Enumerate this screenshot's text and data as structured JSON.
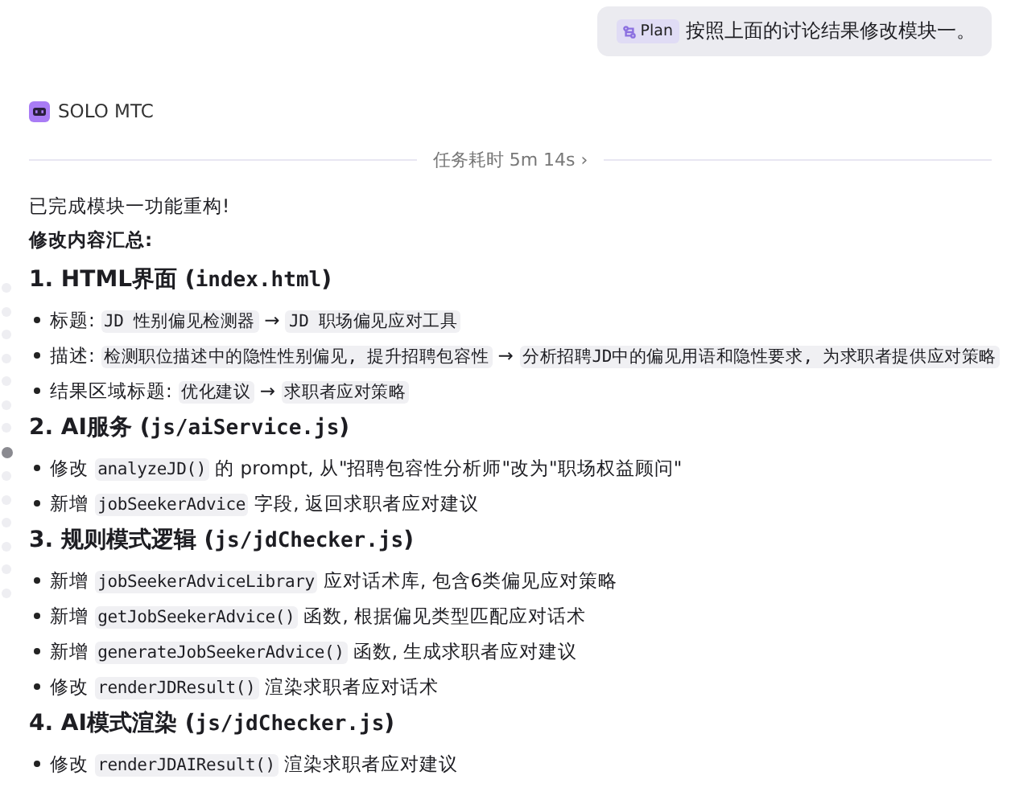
{
  "user_message": {
    "badge": "Plan",
    "text": "按照上面的讨论结果修改模块一。"
  },
  "agent": {
    "name": "SOLO MTC"
  },
  "duration": {
    "label": "任务耗时 5m 14s",
    "chevron": "›"
  },
  "nav_dots": [
    {
      "selected": false
    },
    {
      "selected": false
    },
    {
      "selected": false
    },
    {
      "selected": false
    },
    {
      "selected": false
    },
    {
      "selected": false
    },
    {
      "selected": false
    },
    {
      "selected": true
    },
    {
      "selected": false
    },
    {
      "selected": false
    },
    {
      "selected": false
    },
    {
      "selected": false
    },
    {
      "selected": false
    },
    {
      "selected": false
    }
  ],
  "content": [
    {
      "kind": "paragraph",
      "parts": [
        {
          "kind": "text",
          "text": "已完成模块一功能重构!"
        }
      ]
    },
    {
      "kind": "strong",
      "parts": [
        {
          "kind": "text",
          "text": "修改内容汇总:"
        }
      ]
    },
    {
      "kind": "heading",
      "parts": [
        {
          "kind": "text",
          "text": "1. HTML界面 ("
        },
        {
          "kind": "mono",
          "text": "index.html"
        },
        {
          "kind": "text",
          "text": ")"
        }
      ]
    },
    {
      "kind": "bullet",
      "parts": [
        {
          "kind": "text",
          "text": "标题: "
        },
        {
          "kind": "code",
          "text": "JD 性别偏见检测器"
        },
        {
          "kind": "text",
          "text": " → "
        },
        {
          "kind": "code",
          "text": "JD 职场偏见应对工具"
        }
      ]
    },
    {
      "kind": "bullet",
      "parts": [
        {
          "kind": "text",
          "text": "描述: "
        },
        {
          "kind": "code",
          "text": "检测职位描述中的隐性性别偏见, 提升招聘包容性"
        },
        {
          "kind": "text",
          "text": " → "
        },
        {
          "kind": "code",
          "text": "分析招聘JD中的偏见用语和隐性要求, 为求职者提供应对策略"
        }
      ]
    },
    {
      "kind": "bullet",
      "parts": [
        {
          "kind": "text",
          "text": "结果区域标题: "
        },
        {
          "kind": "code",
          "text": "优化建议"
        },
        {
          "kind": "text",
          "text": " → "
        },
        {
          "kind": "code",
          "text": "求职者应对策略"
        }
      ]
    },
    {
      "kind": "heading",
      "parts": [
        {
          "kind": "text",
          "text": "2. AI服务 ("
        },
        {
          "kind": "mono",
          "text": "js/aiService.js"
        },
        {
          "kind": "text",
          "text": ")"
        }
      ]
    },
    {
      "kind": "bullet",
      "parts": [
        {
          "kind": "text",
          "text": "修改 "
        },
        {
          "kind": "code",
          "text": "analyzeJD()"
        },
        {
          "kind": "text",
          "text": " 的 prompt, 从\"招聘包容性分析师\"改为\"职场权益顾问\""
        }
      ]
    },
    {
      "kind": "bullet",
      "parts": [
        {
          "kind": "text",
          "text": "新增 "
        },
        {
          "kind": "code",
          "text": "jobSeekerAdvice"
        },
        {
          "kind": "text",
          "text": " 字段, 返回求职者应对建议"
        }
      ]
    },
    {
      "kind": "heading",
      "parts": [
        {
          "kind": "text",
          "text": "3. 规则模式逻辑 ("
        },
        {
          "kind": "mono",
          "text": "js/jdChecker.js"
        },
        {
          "kind": "text",
          "text": ")"
        }
      ]
    },
    {
      "kind": "bullet",
      "parts": [
        {
          "kind": "text",
          "text": "新增 "
        },
        {
          "kind": "code",
          "text": "jobSeekerAdviceLibrary"
        },
        {
          "kind": "text",
          "text": " 应对话术库, 包含6类偏见应对策略"
        }
      ]
    },
    {
      "kind": "bullet",
      "parts": [
        {
          "kind": "text",
          "text": "新增 "
        },
        {
          "kind": "code",
          "text": "getJobSeekerAdvice()"
        },
        {
          "kind": "text",
          "text": " 函数, 根据偏见类型匹配应对话术"
        }
      ]
    },
    {
      "kind": "bullet",
      "parts": [
        {
          "kind": "text",
          "text": "新增 "
        },
        {
          "kind": "code",
          "text": "generateJobSeekerAdvice()"
        },
        {
          "kind": "text",
          "text": " 函数, 生成求职者应对建议"
        }
      ]
    },
    {
      "kind": "bullet",
      "parts": [
        {
          "kind": "text",
          "text": "修改 "
        },
        {
          "kind": "code",
          "text": "renderJDResult()"
        },
        {
          "kind": "text",
          "text": " 渲染求职者应对话术"
        }
      ]
    },
    {
      "kind": "heading",
      "parts": [
        {
          "kind": "text",
          "text": "4. AI模式渲染 ("
        },
        {
          "kind": "mono",
          "text": "js/jdChecker.js"
        },
        {
          "kind": "text",
          "text": ")"
        }
      ]
    },
    {
      "kind": "bullet",
      "parts": [
        {
          "kind": "text",
          "text": "修改 "
        },
        {
          "kind": "code",
          "text": "renderJDAIResult()"
        },
        {
          "kind": "text",
          "text": " 渲染求职者应对建议"
        }
      ]
    }
  ]
}
